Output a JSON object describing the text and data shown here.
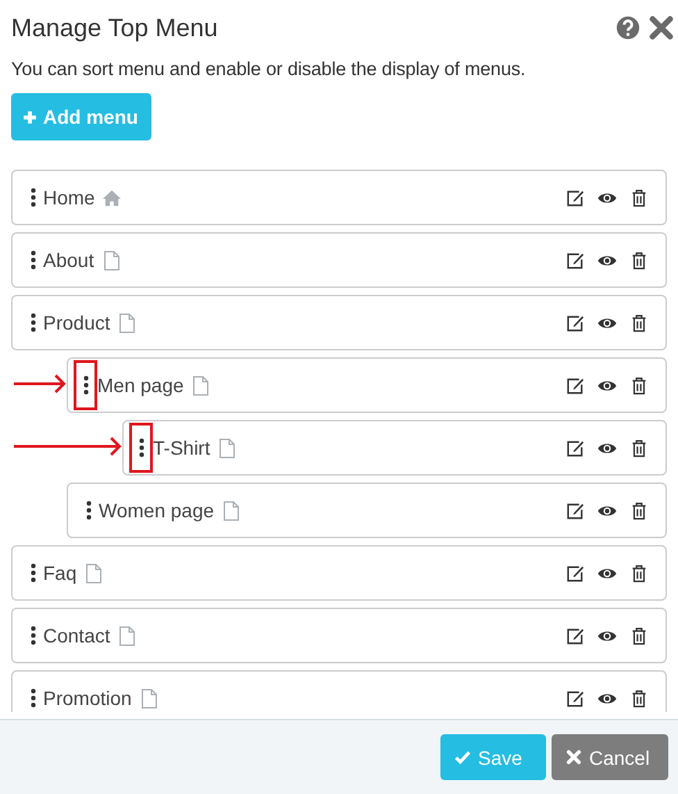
{
  "title": "Manage Top Menu",
  "description": "You can sort menu and enable or disable the display of menus.",
  "add_button": "Add menu",
  "items": [
    {
      "label": "Home",
      "kind": "home",
      "marked": false
    },
    {
      "label": "About",
      "kind": "page",
      "marked": false
    },
    {
      "label": "Product",
      "kind": "page",
      "marked": false,
      "children": [
        {
          "label": "Men page",
          "kind": "page",
          "marked": true,
          "children": [
            {
              "label": "T-Shirt",
              "kind": "page",
              "marked": true
            }
          ]
        },
        {
          "label": "Women page",
          "kind": "page",
          "marked": false
        }
      ]
    },
    {
      "label": "Faq",
      "kind": "page",
      "marked": false
    },
    {
      "label": "Contact",
      "kind": "page",
      "marked": false
    },
    {
      "label": "Promotion",
      "kind": "page",
      "marked": false
    }
  ],
  "buttons": [
    {
      "label": "Save",
      "kind": "save"
    },
    {
      "label": "Cancel",
      "kind": "cancel"
    }
  ]
}
